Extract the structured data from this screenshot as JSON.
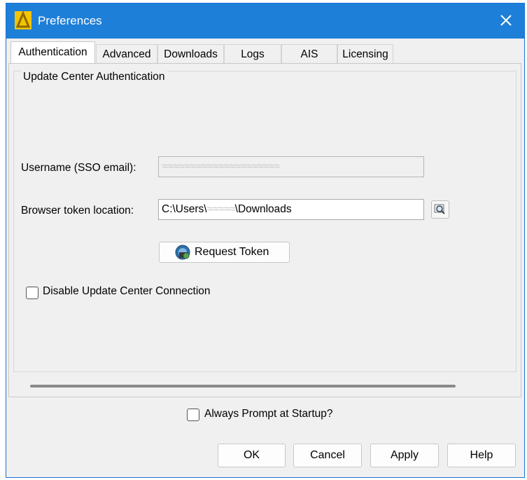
{
  "window": {
    "title": "Preferences",
    "accent_color": "#1e7fd8"
  },
  "tabs": [
    {
      "label": "Authentication",
      "active": true
    },
    {
      "label": "Advanced",
      "active": false
    },
    {
      "label": "Downloads",
      "active": false
    },
    {
      "label": "Logs",
      "active": false
    },
    {
      "label": "AIS",
      "active": false
    },
    {
      "label": "Licensing",
      "active": false
    }
  ],
  "auth": {
    "group_title": "Update Center Authentication",
    "username_label": "Username (SSO email):",
    "username_value": "≈≈≈≈≈≈≈≈≈≈≈≈≈≈≈≈≈≈≈≈≈",
    "browser_label": "Browser token location:",
    "browser_prefix": "C:\\Users\\",
    "browser_user": "≈≈≈≈≈",
    "browser_suffix": "\\Downloads",
    "request_token_label": "Request Token",
    "disable_label": "Disable Update Center Connection",
    "disable_checked": false
  },
  "footer": {
    "always_prompt_label": "Always Prompt at Startup?",
    "always_prompt_checked": false,
    "ok_label": "OK",
    "cancel_label": "Cancel",
    "apply_label": "Apply",
    "help_label": "Help"
  }
}
